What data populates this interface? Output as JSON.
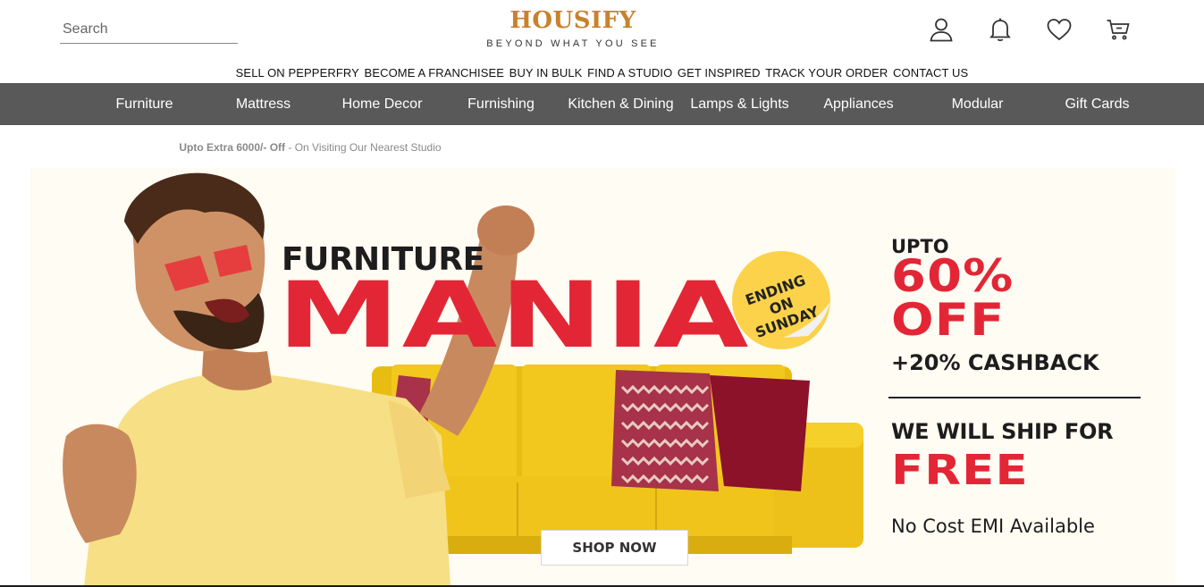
{
  "header": {
    "search_placeholder": "Search",
    "logo_name": "HOUSIFY",
    "logo_tagline": "BEYOND WHAT YOU SEE",
    "icons": [
      "user-icon",
      "bell-icon",
      "heart-icon",
      "cart-icon"
    ]
  },
  "utility_links": [
    "SELL ON PEPPERFRY",
    "BECOME A FRANCHISEE",
    "BUY IN BULK",
    "FIND A STUDIO",
    "GET INSPIRED",
    "TRACK YOUR ORDER",
    "CONTACT US"
  ],
  "nav": {
    "items": [
      "Furniture",
      "Mattress",
      "Home Decor",
      "Furnishing",
      "Kitchen & Dining",
      "Lamps & Lights",
      "Appliances",
      "Modular",
      "Gift Cards"
    ]
  },
  "marquee": {
    "bold": "t Upto Extra 6000/- Off",
    "rest": " - On Visiting Our Nearest Studio"
  },
  "banner": {
    "headline_small": "FURNITURE",
    "headline_big": "MANIA",
    "sticker": "ENDING ON SUNDAY",
    "upto": "UPTO",
    "discount": "60%",
    "off": "OFF",
    "cashback": "+20% CASHBACK",
    "ship": "WE WILL SHIP FOR",
    "free": "FREE",
    "emi": "No Cost EMI Available",
    "cta": "SHOP NOW"
  },
  "colors": {
    "brand": "#c9822c",
    "nav_bg": "#595959",
    "accent_red": "#e32636",
    "sofa_yellow": "#f2c81e",
    "banner_bg": "#fefcf3"
  }
}
